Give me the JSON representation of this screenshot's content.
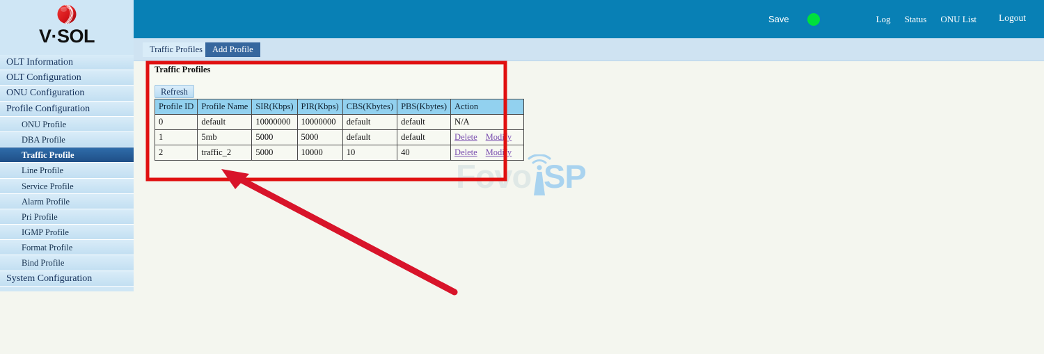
{
  "brand": {
    "logo_text": "V·SOL",
    "logo_icon": "vsol-globe-icon"
  },
  "topbar": {
    "save_label": "Save",
    "status_indicator": "green-status-dot",
    "status_color": "#00e03c",
    "links": [
      {
        "label": "Log"
      },
      {
        "label": "Status"
      },
      {
        "label": "ONU List"
      },
      {
        "label": "Logout"
      }
    ]
  },
  "sidebar": {
    "items": [
      {
        "label": "OLT Information",
        "level": "top",
        "active": false
      },
      {
        "label": "OLT Configuration",
        "level": "top",
        "active": false
      },
      {
        "label": "ONU Configuration",
        "level": "top",
        "active": false
      },
      {
        "label": "Profile Configuration",
        "level": "top",
        "active": false
      },
      {
        "label": "ONU Profile",
        "level": "sub",
        "active": false
      },
      {
        "label": "DBA Profile",
        "level": "sub",
        "active": false
      },
      {
        "label": "Traffic Profile",
        "level": "sub",
        "active": true
      },
      {
        "label": "Line Profile",
        "level": "sub",
        "active": false
      },
      {
        "label": "Service Profile",
        "level": "sub",
        "active": false
      },
      {
        "label": "Alarm Profile",
        "level": "sub",
        "active": false
      },
      {
        "label": "Pri Profile",
        "level": "sub",
        "active": false
      },
      {
        "label": "IGMP Profile",
        "level": "sub",
        "active": false
      },
      {
        "label": "Format Profile",
        "level": "sub",
        "active": false
      },
      {
        "label": "Bind Profile",
        "level": "sub",
        "active": false
      },
      {
        "label": "System Configuration",
        "level": "top",
        "active": false
      }
    ]
  },
  "tabs": [
    {
      "label": "Traffic Profiles",
      "selected": false
    },
    {
      "label": "Add Profile",
      "selected": true
    }
  ],
  "panel": {
    "title": "Traffic Profiles",
    "refresh_label": "Refresh",
    "table": {
      "columns": [
        "Profile ID",
        "Profile Name",
        "SIR(Kbps)",
        "PIR(Kbps)",
        "CBS(Kbytes)",
        "PBS(Kbytes)",
        "Action"
      ],
      "rows": [
        {
          "profile_id": "0",
          "profile_name": "default",
          "sir": "10000000",
          "pir": "10000000",
          "cbs": "default",
          "pbs": "default",
          "action_text": "N/A",
          "has_links": false
        },
        {
          "profile_id": "1",
          "profile_name": "5mb",
          "sir": "5000",
          "pir": "5000",
          "cbs": "default",
          "pbs": "default",
          "action_text": "",
          "has_links": true,
          "delete_label": "Delete",
          "modify_label": "Modify"
        },
        {
          "profile_id": "2",
          "profile_name": "traffic_2",
          "sir": "5000",
          "pir": "10000",
          "cbs": "10",
          "pbs": "40",
          "action_text": "",
          "has_links": true,
          "delete_label": "Delete",
          "modify_label": "Modify"
        }
      ]
    }
  },
  "watermark": {
    "text_faint": "Fovo",
    "text_bright": "SP",
    "icon": "antenna-tower-icon"
  },
  "annotation": {
    "highlight_color": "#e01010",
    "arrow_color": "#d8142a",
    "note": "red-box-and-arrow-callout"
  },
  "colors": {
    "header_blue": "#0880b5",
    "sidebar_blue": "#cfe6f5",
    "active_nav": "#2f6dab",
    "tab_selected": "#36679e",
    "table_header": "#92d1ef",
    "page_bg": "#f4f6ef",
    "link_purple": "#7b4fb0"
  }
}
